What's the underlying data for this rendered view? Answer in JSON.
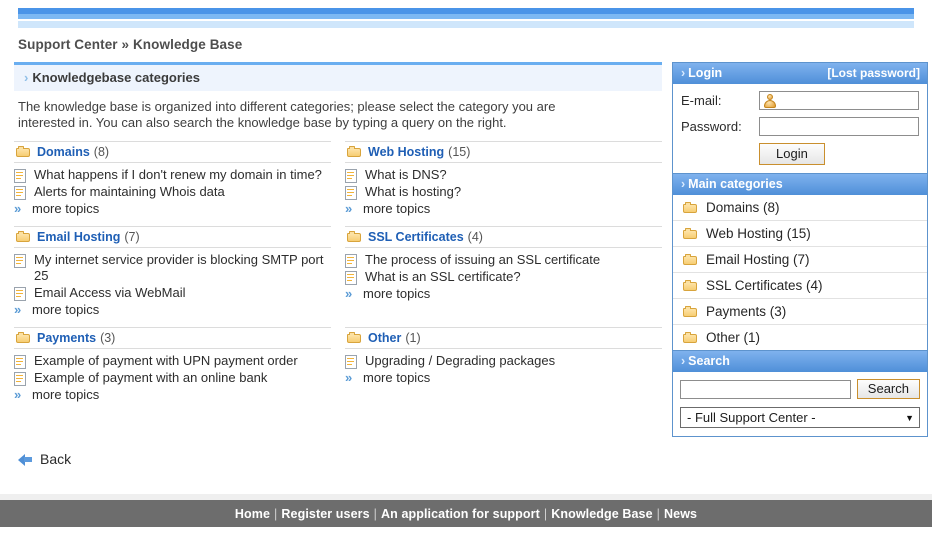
{
  "breadcrumb": "Support Center » Knowledge Base",
  "kb": {
    "header": "Knowledgebase categories",
    "chevron": "›",
    "intro": "The knowledge base is organized into different categories; please select the category you are interested in. You can also search the knowledge base by typing a query on the right.",
    "more_label": "more topics",
    "more_arrows": "»",
    "categories": [
      {
        "title": "Domains",
        "count": "(8)",
        "topics": [
          "What happens if I don't renew my domain in time?",
          "Alerts for maintaining Whois data"
        ]
      },
      {
        "title": "Web Hosting",
        "count": "(15)",
        "topics": [
          "What is DNS?",
          "What is hosting?"
        ]
      },
      {
        "title": "Email Hosting",
        "count": "(7)",
        "topics": [
          "My internet service provider is blocking SMTP port 25",
          "Email Access via WebMail"
        ]
      },
      {
        "title": "SSL Certificates",
        "count": "(4)",
        "topics": [
          "The process of issuing an SSL certificate",
          "What is an SSL certificate?"
        ]
      },
      {
        "title": "Payments",
        "count": "(3)",
        "topics": [
          "Example of payment with UPN payment order",
          "Example of payment with an online bank"
        ]
      },
      {
        "title": "Other",
        "count": "(1)",
        "topics": [
          "Upgrading / Degrading packages"
        ]
      }
    ]
  },
  "back": {
    "label": "Back"
  },
  "login": {
    "title": "Login",
    "chevron": "›",
    "lost_password": "[Lost password]",
    "email_label": "E-mail:",
    "email_value": "",
    "password_label": "Password:",
    "password_value": "",
    "button": "Login"
  },
  "main_categories": {
    "title": "Main categories",
    "chevron": "›",
    "items": [
      {
        "label": "Domains (8)"
      },
      {
        "label": "Web Hosting (15)"
      },
      {
        "label": "Email Hosting (7)"
      },
      {
        "label": "SSL Certificates (4)"
      },
      {
        "label": "Payments (3)"
      },
      {
        "label": "Other (1)"
      }
    ]
  },
  "search": {
    "title": "Search",
    "chevron": "›",
    "input_value": "",
    "button": "Search",
    "scope_selected": "- Full Support Center -",
    "caret": "▼"
  },
  "footer": {
    "links": [
      "Home",
      "Register users",
      "An application for support",
      "Knowledge Base",
      "News"
    ],
    "separator": "|"
  },
  "colors": {
    "accent_blue": "#4a94e8",
    "panel_border": "#5d93cd",
    "link_blue": "#1f5fb5",
    "footer_gray": "#6d6d6d",
    "folder_gold": "#f7cd73"
  }
}
